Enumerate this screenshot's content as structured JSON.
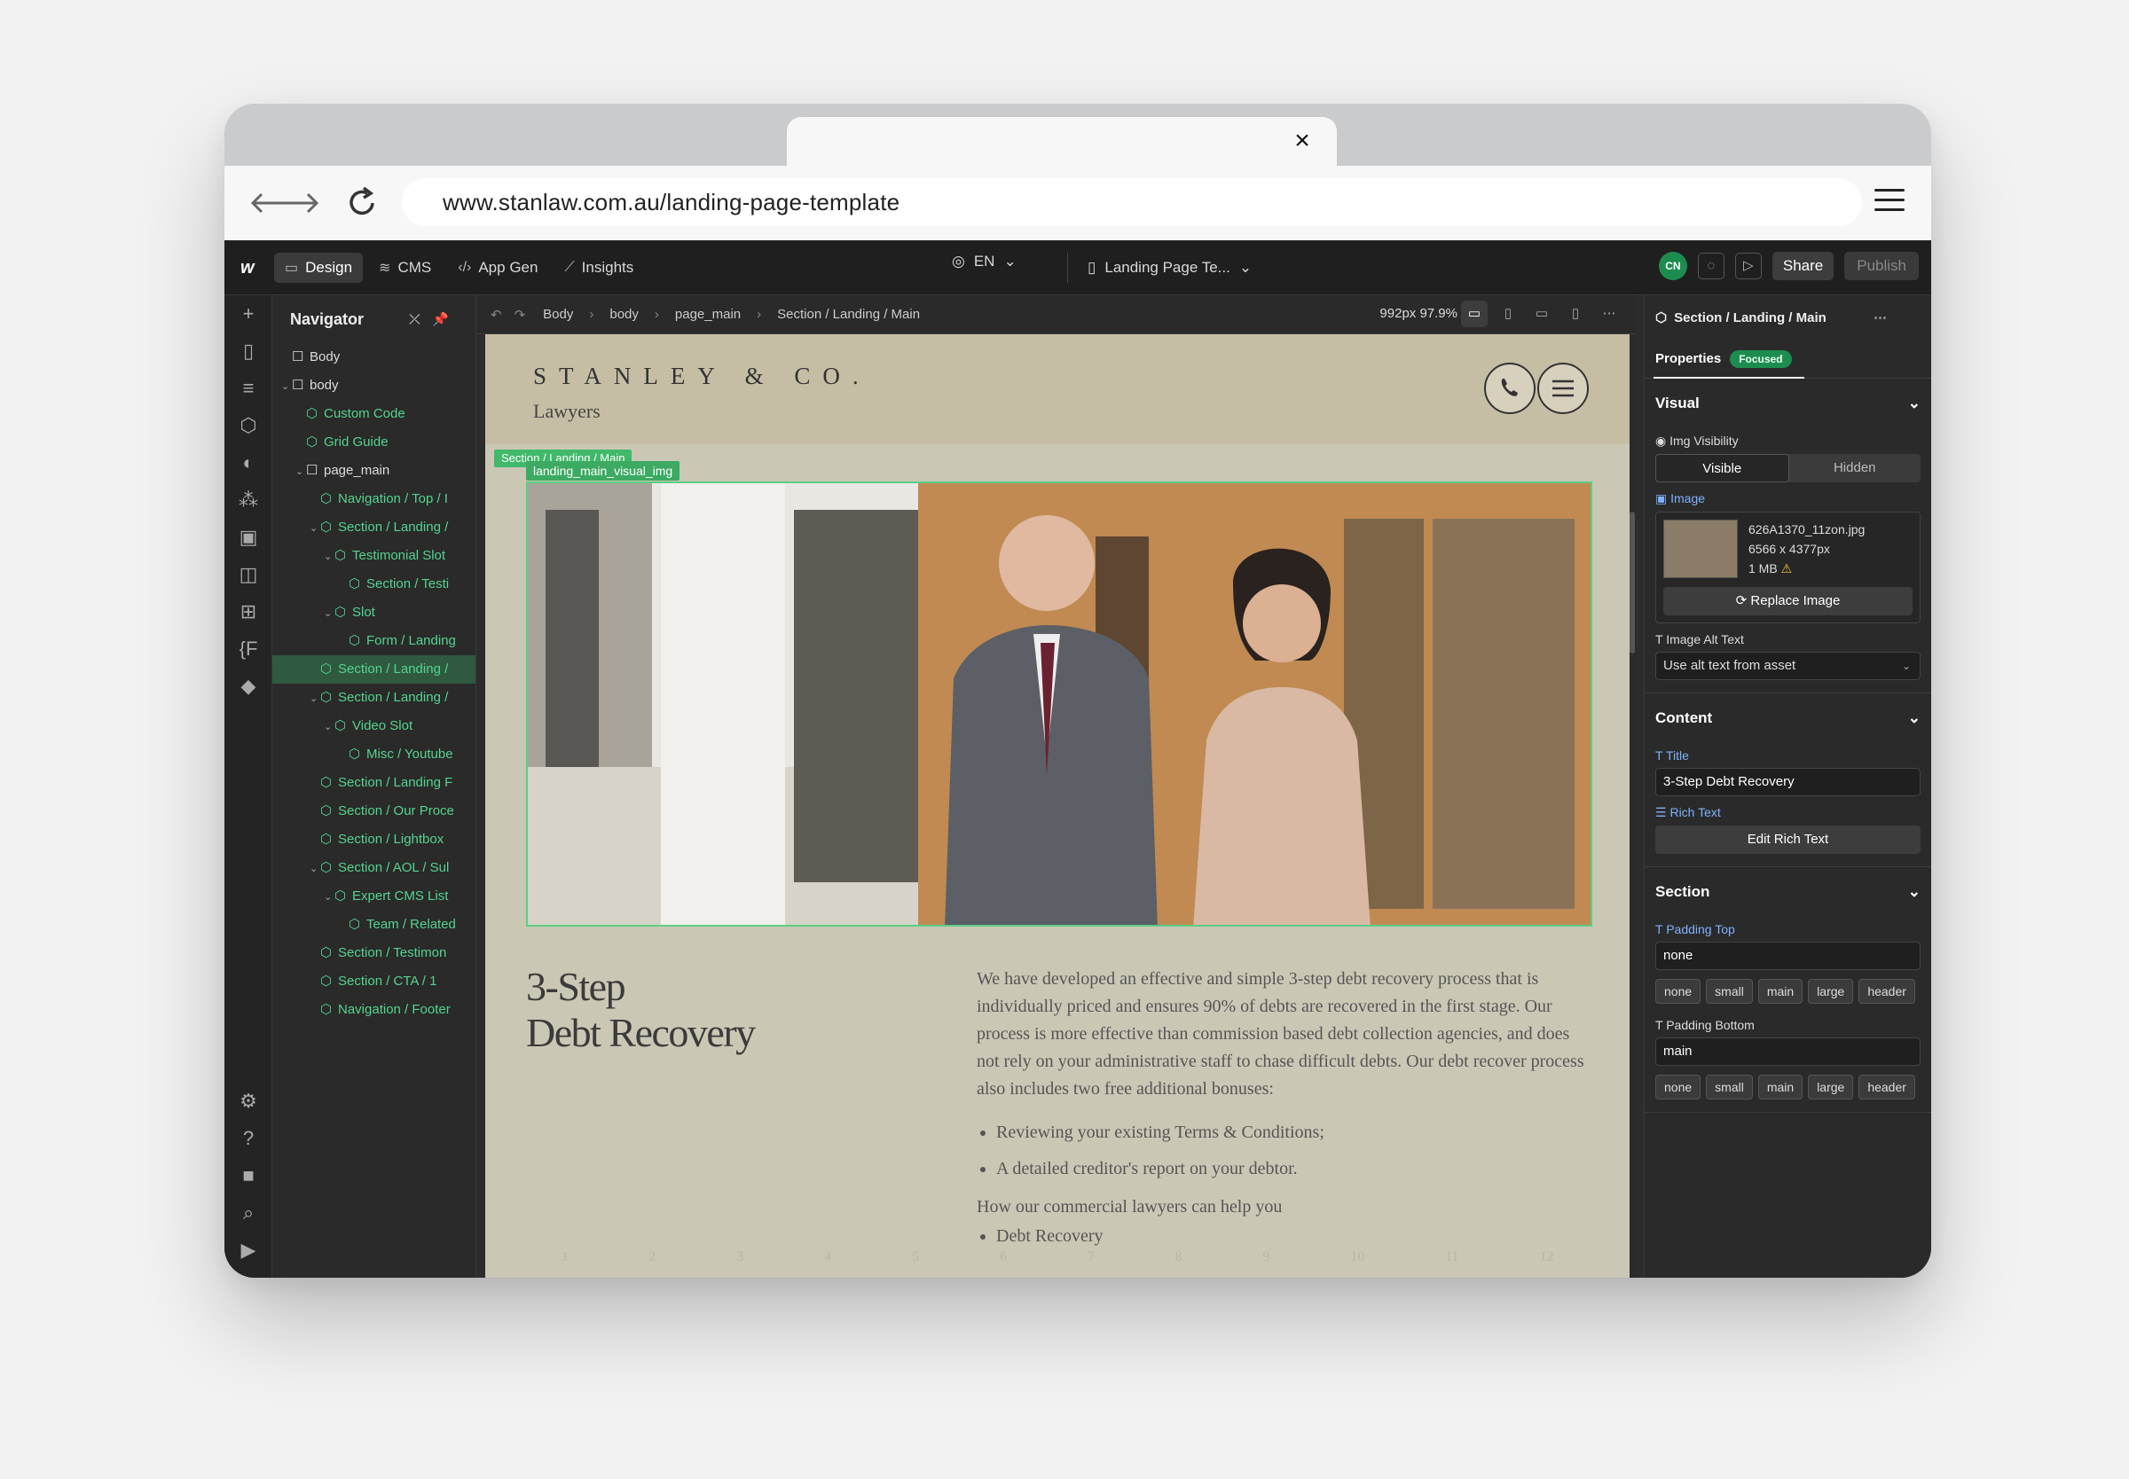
{
  "browser": {
    "url": "www.stanlaw.com.au/landing-page-template",
    "tab_close": "×"
  },
  "toolbar": {
    "logo": "w",
    "modes": [
      {
        "label": "Design",
        "icon": "design-icon"
      },
      {
        "label": "CMS",
        "icon": "database-icon"
      },
      {
        "label": "App Gen",
        "icon": "code-icon"
      },
      {
        "label": "Insights",
        "icon": "chart-icon"
      }
    ],
    "language": "EN",
    "page_name": "Landing Page Te...",
    "avatar": "CN",
    "share": "Share",
    "publish": "Publish"
  },
  "navigator": {
    "title": "Navigator",
    "items": [
      {
        "label": "Body",
        "type": "plain",
        "depth": 0
      },
      {
        "label": "body",
        "type": "plain",
        "depth": 0
      },
      {
        "label": "Custom Code",
        "type": "component",
        "depth": 1
      },
      {
        "label": "Grid Guide",
        "type": "component",
        "depth": 1
      },
      {
        "label": "page_main",
        "type": "plain",
        "depth": 1
      },
      {
        "label": "Navigation / Top / I",
        "type": "component",
        "depth": 2
      },
      {
        "label": "Section / Landing /",
        "type": "component",
        "depth": 2
      },
      {
        "label": "Testimonial Slot",
        "type": "component",
        "depth": 3
      },
      {
        "label": "Section / Testi",
        "type": "component",
        "depth": 4
      },
      {
        "label": "Slot",
        "type": "component",
        "depth": 3
      },
      {
        "label": "Form / Landing",
        "type": "component",
        "depth": 4
      },
      {
        "label": "Section / Landing /",
        "type": "component",
        "depth": 2
      },
      {
        "label": "Section / Landing /",
        "type": "component",
        "depth": 2
      },
      {
        "label": "Video Slot",
        "type": "component",
        "depth": 3
      },
      {
        "label": "Misc / Youtube",
        "type": "component",
        "depth": 4
      },
      {
        "label": "Section / Landing F",
        "type": "component",
        "depth": 2
      },
      {
        "label": "Section / Our Proce",
        "type": "component",
        "depth": 2
      },
      {
        "label": "Section / Lightbox",
        "type": "component",
        "depth": 2
      },
      {
        "label": "Section / AOL / Sul",
        "type": "component",
        "depth": 2
      },
      {
        "label": "Expert CMS List",
        "type": "component",
        "depth": 3
      },
      {
        "label": "Team / Related",
        "type": "component",
        "depth": 4
      },
      {
        "label": "Section / Testimon",
        "type": "component",
        "depth": 2
      },
      {
        "label": "Section / CTA / 1",
        "type": "component",
        "depth": 2
      },
      {
        "label": "Navigation / Footer",
        "type": "component",
        "depth": 2
      }
    ]
  },
  "canvas_bar": {
    "breadcrumbs": [
      "Body",
      "body",
      "page_main",
      "Section / Landing / Main"
    ],
    "zoom": "992px 97.9%"
  },
  "site": {
    "brand": "STANLEY & CO.",
    "brand_sub": "Lawyers",
    "selected_section_tag": "Section / Landing / Main",
    "selected_image_tag": "landing_main_visual_img",
    "title_line1": "3-Step",
    "title_line2": "Debt Recovery",
    "paragraph": "We have developed an effective and simple 3-step debt recovery process that is individually priced and ensures 90% of debts are recovered in the first stage. Our process is more effective than commission based debt collection agencies, and does not rely on your administrative staff to chase difficult debts. Our debt recover process also includes two free additional bonuses:",
    "bullets": [
      "Reviewing your existing Terms & Conditions;",
      "A detailed creditor's report on your debtor."
    ],
    "subhead": "How our commercial lawyers can help you",
    "cut_item": "Debt Recovery",
    "grid_columns": [
      "1",
      "2",
      "3",
      "4",
      "5",
      "6",
      "7",
      "8",
      "9",
      "10",
      "11",
      "12"
    ]
  },
  "panel": {
    "title": "Section / Landing / Main",
    "tab": "Properties",
    "badge": "Focused",
    "visual": {
      "heading": "Visual",
      "img_visibility_label": "Img Visibility",
      "visible": "Visible",
      "hidden": "Hidden",
      "image_label": "Image",
      "file_name": "626A1370_11zon.jpg",
      "dimensions": "6566 x 4377px",
      "file_size": "1 MB",
      "warning": "⚠",
      "replace": "Replace Image",
      "alt_label": "Image Alt Text",
      "alt_value": "Use alt text from asset"
    },
    "content": {
      "heading": "Content",
      "title_label": "Title",
      "title_value": "3-Step Debt Recovery",
      "rich_label": "Rich Text",
      "rich_button": "Edit Rich Text"
    },
    "section": {
      "heading": "Section",
      "pad_top_label": "Padding Top",
      "pad_top_value": "none",
      "pad_bottom_label": "Padding Bottom",
      "pad_bottom_value": "main",
      "options": [
        "none",
        "small",
        "main",
        "large",
        "header"
      ]
    }
  },
  "colors": {
    "canvas_bg": "#cbc7b5",
    "header_bg": "#c6bea4",
    "selection_green": "#40b96a",
    "focused_badge": "#1d8d4f"
  }
}
